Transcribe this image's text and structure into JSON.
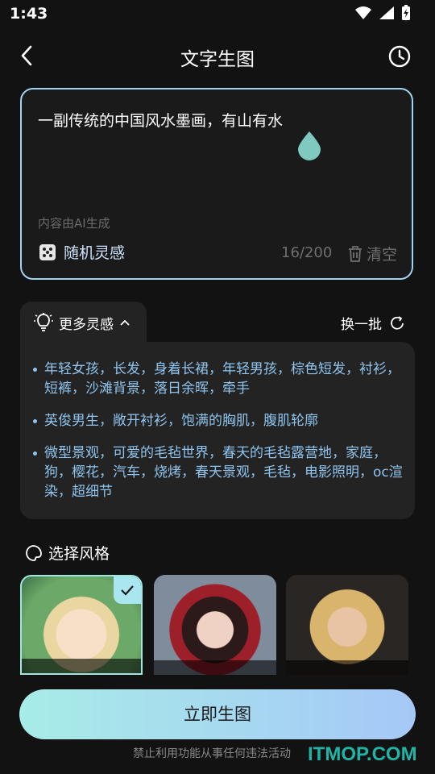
{
  "status_bar": {
    "time": "1:43",
    "icons": [
      "wifi-icon",
      "signal-icon",
      "battery-charging-icon"
    ]
  },
  "header": {
    "title": "文字生图",
    "back_icon": "chevron-left-icon",
    "history_icon": "clock-icon"
  },
  "prompt": {
    "text": "一副传统的中国风水墨画，有山有水",
    "ai_note": "内容由AI生成",
    "random_label": "随机灵感",
    "random_icon": "dice-icon",
    "counter": "16/200",
    "clear_label": "清空",
    "clear_icon": "trash-icon"
  },
  "inspiration": {
    "tab_label": "更多灵感",
    "tab_icon": "lightbulb-icon",
    "refresh_label": "换一批",
    "refresh_icon": "refresh-icon",
    "items": [
      "年轻女孩，长发，身着长裙，年轻男孩，棕色短发，衬衫，短裤，沙滩背景，落日余晖，牵手",
      "英俊男生，敞开衬衫，饱满的胸肌，腹肌轮廓",
      "微型景观，可爱的毛毡世界，春天的毛毡露营地，家庭，狗，樱花，汽车，烧烤，春天景观，毛毡，电影照明，oc渲染，超细节"
    ]
  },
  "style": {
    "title": "选择风格",
    "icon": "palette-icon",
    "cards": [
      {
        "name": "anime-girl-blonde",
        "selected": true
      },
      {
        "name": "ancient-style-girl",
        "selected": false
      },
      {
        "name": "realistic-portrait",
        "selected": false
      }
    ]
  },
  "generate_label": "立即生图",
  "disclaimer": "禁止利用功能从事任何违法活动",
  "watermark": "ITMOP.COM",
  "colors": {
    "accent_border": "#9fd3f0",
    "button_start": "#a7ece7",
    "button_end": "#a6c8f7",
    "link_blue": "#8fc4ee"
  }
}
